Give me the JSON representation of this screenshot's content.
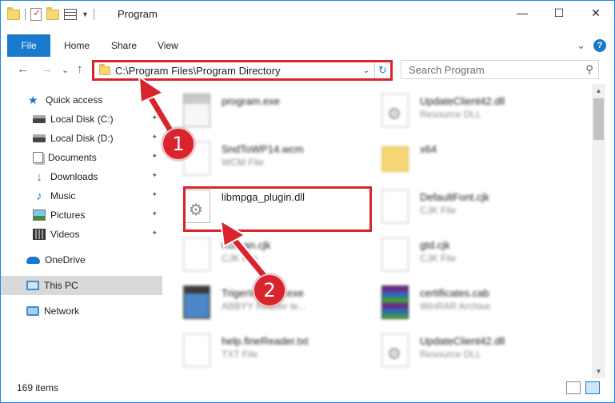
{
  "window": {
    "title": "Program",
    "buttons": {
      "minimize": "—",
      "maximize": "☐",
      "close": "✕"
    }
  },
  "ribbon": {
    "file_tab": "File",
    "tabs": [
      "Home",
      "Share",
      "View"
    ],
    "help": "?",
    "expand": "⌄"
  },
  "nav": {
    "back": "←",
    "forward": "→",
    "recent": "⌄",
    "up": "↑",
    "address": "C:\\Program Files\\Program Directory",
    "address_dropdown": "⌄",
    "refresh": "↻",
    "search_placeholder": "Search Program",
    "search_icon": "⚲"
  },
  "sidebar": {
    "items": [
      {
        "label": "Quick access",
        "icon": "star-icon"
      },
      {
        "label": "Local Disk (C:)",
        "icon": "drive-icon",
        "pinned": true
      },
      {
        "label": "Local Disk (D:)",
        "icon": "drive-icon",
        "pinned": true
      },
      {
        "label": "Documents",
        "icon": "documents-icon",
        "pinned": true
      },
      {
        "label": "Downloads",
        "icon": "download-icon",
        "pinned": true
      },
      {
        "label": "Music",
        "icon": "music-icon",
        "pinned": true
      },
      {
        "label": "Pictures",
        "icon": "pictures-icon",
        "pinned": true
      },
      {
        "label": "Videos",
        "icon": "videos-icon",
        "pinned": true
      },
      {
        "label": "OneDrive",
        "icon": "cloud-icon"
      },
      {
        "label": "This PC",
        "icon": "computer-icon",
        "selected": true
      },
      {
        "label": "Network",
        "icon": "network-icon"
      }
    ],
    "pin_glyph": "📌"
  },
  "files": [
    {
      "name": "program.exe",
      "type": "",
      "icon": "installer-icon",
      "blurred": true
    },
    {
      "name": "UpdateClient42.dll",
      "type": "Resource DLL",
      "icon": "dll-icon",
      "blurred": true
    },
    {
      "name": "SndToWP14.wcm",
      "type": "WCM File",
      "icon": "file-icon",
      "blurred": true
    },
    {
      "name": "x64",
      "type": "",
      "icon": "folder-icon",
      "blurred": true
    },
    {
      "name": "libmpga_plugin.dll",
      "type": "",
      "icon": "dll-icon",
      "blurred": false
    },
    {
      "name": "DefaultFont.cjk",
      "type": "CJK File",
      "icon": "file-icon",
      "blurred": true
    },
    {
      "name": "Korean.cjk",
      "type": "CJK File",
      "icon": "file-icon",
      "blurred": true
    },
    {
      "name": "gtd.cjk",
      "type": "CJK File",
      "icon": "file-icon",
      "blurred": true
    },
    {
      "name": "TrigerInstaller.exe",
      "type": "ABBYY Reader te...",
      "icon": "app-icon",
      "blurred": true
    },
    {
      "name": "certificates.cab",
      "type": "WinRAR Archive",
      "icon": "archive-icon",
      "blurred": true
    },
    {
      "name": "help.fineReader.txt",
      "type": "TXT File",
      "icon": "file-icon",
      "blurred": true
    },
    {
      "name": "UpdateClient42.dll",
      "type": "Resource DLL",
      "icon": "dll-icon",
      "blurred": true
    }
  ],
  "status": {
    "item_count": "169 items"
  },
  "annotations": {
    "step1": "1",
    "step2": "2",
    "color": "#d9242d"
  }
}
